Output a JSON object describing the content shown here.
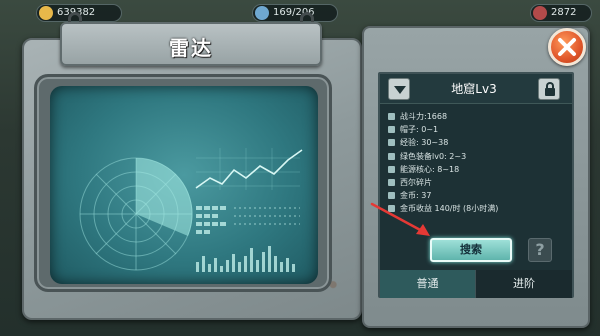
{
  "hud": {
    "coins": "639382",
    "population": "169/206",
    "gems": "2872"
  },
  "device": {
    "title": "雷达"
  },
  "info_panel": {
    "level_title": "地窟Lv3",
    "stats": [
      "战斗力:1668",
      "帽子: 0~1",
      "经验: 30~38",
      "绿色装备lv0: 2~3",
      "能源核心: 8~18",
      "西尔碎片",
      "金币: 37",
      "金币收益 140/时 (8小时满)"
    ],
    "search_label": "搜索",
    "help_label": "?",
    "tabs": [
      "普通",
      "进阶"
    ]
  },
  "colors": {
    "screen_teal": "#2f7880",
    "accent_button": "#5fb4ac",
    "close_button": "#e0562a",
    "annotation_arrow": "#e53935"
  },
  "icons": {
    "close": "close-icon",
    "dropdown": "triangle-down-icon",
    "lock": "lock-icon",
    "help": "question-mark-icon"
  }
}
